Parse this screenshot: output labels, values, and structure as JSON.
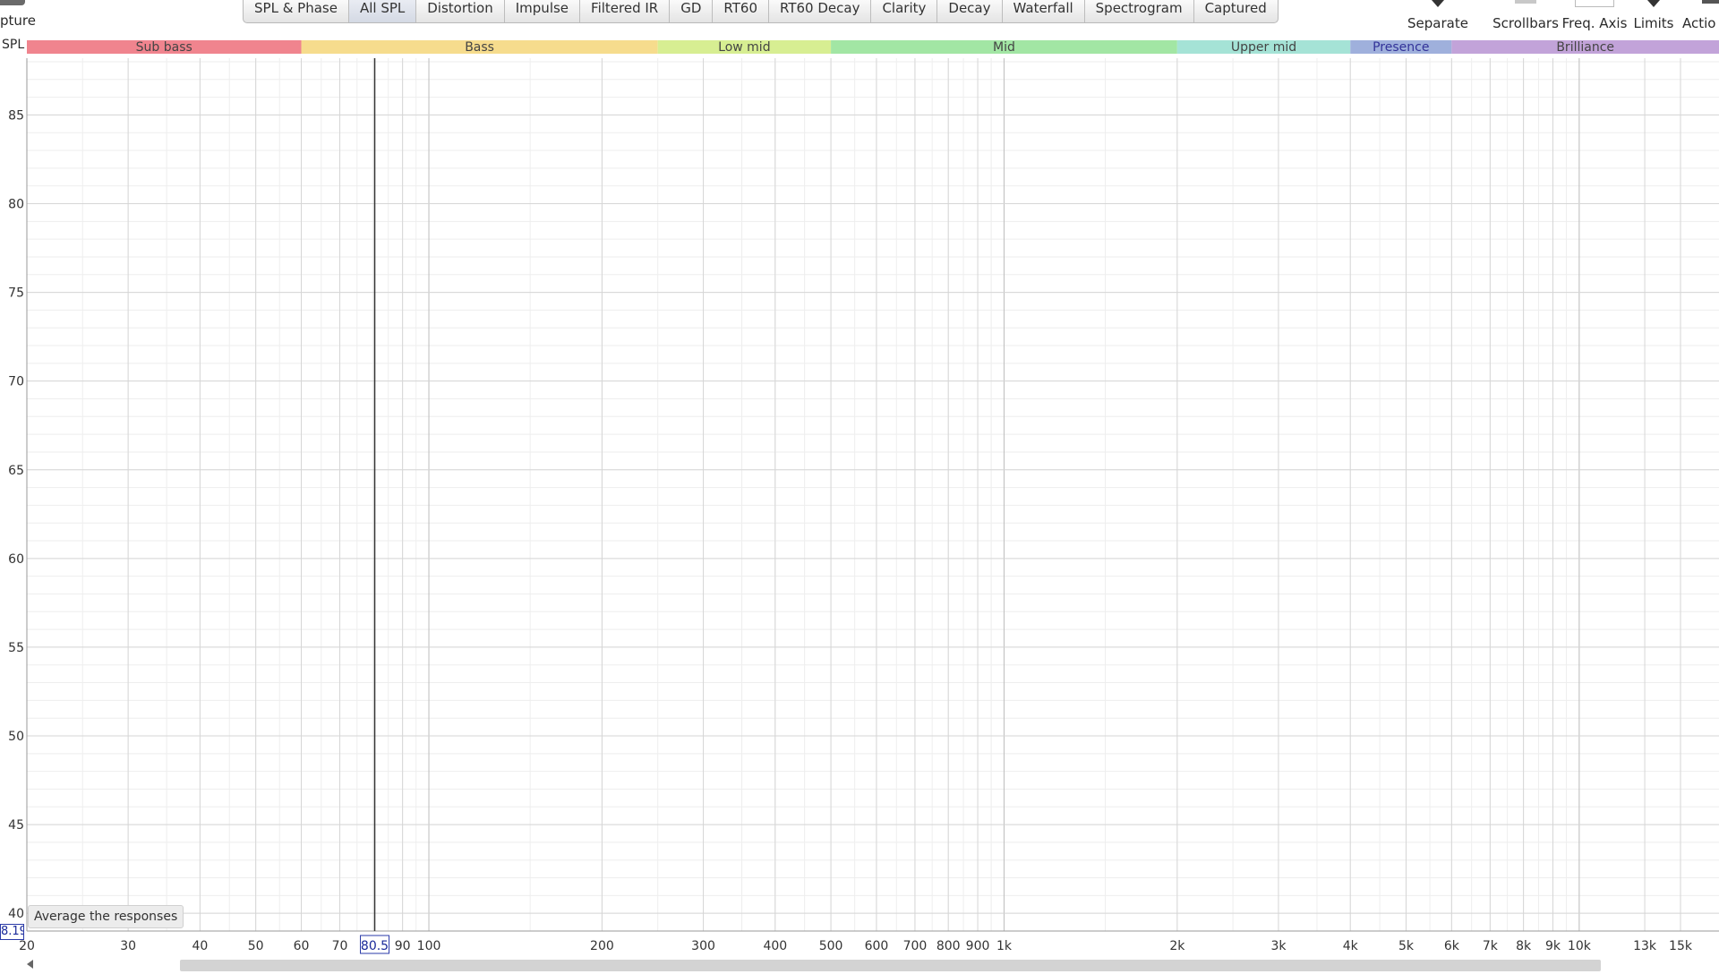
{
  "capture_label": "pture",
  "tabs": [
    {
      "label": "SPL & Phase",
      "active": false
    },
    {
      "label": "All SPL",
      "active": true
    },
    {
      "label": "Distortion",
      "active": false
    },
    {
      "label": "Impulse",
      "active": false
    },
    {
      "label": "Filtered IR",
      "active": false
    },
    {
      "label": "GD",
      "active": false
    },
    {
      "label": "RT60",
      "active": false
    },
    {
      "label": "RT60 Decay",
      "active": false
    },
    {
      "label": "Clarity",
      "active": false
    },
    {
      "label": "Decay",
      "active": false
    },
    {
      "label": "Waterfall",
      "active": false
    },
    {
      "label": "Spectrogram",
      "active": false
    },
    {
      "label": "Captured",
      "active": false
    }
  ],
  "toolbar": {
    "separate": "Separate",
    "scrollbars": "Scrollbars",
    "freq_axis": "Freq. Axis",
    "limits": "Limits",
    "actions": "Actio"
  },
  "y_axis_label": "SPL",
  "average_button": "Average the responses",
  "cursor": {
    "y_value": "8.19",
    "x_value": "80.5",
    "x_freq": 80.5
  },
  "bands": [
    {
      "label": "Sub bass",
      "from": 20,
      "to": 60,
      "color": "#f0848e",
      "text_color": "#444444"
    },
    {
      "label": "Bass",
      "from": 60,
      "to": 250,
      "color": "#f6dc8d",
      "text_color": "#444444"
    },
    {
      "label": "Low mid",
      "from": 250,
      "to": 500,
      "color": "#d7ee92",
      "text_color": "#444444"
    },
    {
      "label": "Mid",
      "from": 500,
      "to": 2000,
      "color": "#a2e6a4",
      "text_color": "#444444"
    },
    {
      "label": "Upper mid",
      "from": 2000,
      "to": 4000,
      "color": "#a5e3d6",
      "text_color": "#444444"
    },
    {
      "label": "Presence",
      "from": 4000,
      "to": 6000,
      "color": "#9fb0dc",
      "text_color": "#333399"
    },
    {
      "label": "Brilliance",
      "from": 6000,
      "to": 20000,
      "color": "#c2a3d9",
      "text_color": "#444444"
    }
  ],
  "chart_data": {
    "type": "line",
    "title": "",
    "xlabel": "",
    "ylabel": "SPL",
    "x_scale": "log",
    "xlim": [
      20,
      17500
    ],
    "ylim": [
      39,
      88.2
    ],
    "grid": true,
    "series": [],
    "y_ticks": [
      {
        "v": 40,
        "label": "40"
      },
      {
        "v": 45,
        "label": "45"
      },
      {
        "v": 50,
        "label": "50"
      },
      {
        "v": 55,
        "label": "55"
      },
      {
        "v": 60,
        "label": "60"
      },
      {
        "v": 65,
        "label": "65"
      },
      {
        "v": 70,
        "label": "70"
      },
      {
        "v": 75,
        "label": "75"
      },
      {
        "v": 80,
        "label": "80"
      },
      {
        "v": 85,
        "label": "85"
      }
    ],
    "x_ticks": [
      {
        "v": 20,
        "label": "20"
      },
      {
        "v": 30,
        "label": "30"
      },
      {
        "v": 40,
        "label": "40"
      },
      {
        "v": 50,
        "label": "50"
      },
      {
        "v": 60,
        "label": "60"
      },
      {
        "v": 70,
        "label": "70"
      },
      {
        "v": 90,
        "label": "90"
      },
      {
        "v": 100,
        "label": "100"
      },
      {
        "v": 200,
        "label": "200"
      },
      {
        "v": 300,
        "label": "300"
      },
      {
        "v": 400,
        "label": "400"
      },
      {
        "v": 500,
        "label": "500"
      },
      {
        "v": 600,
        "label": "600"
      },
      {
        "v": 700,
        "label": "700"
      },
      {
        "v": 800,
        "label": "800"
      },
      {
        "v": 900,
        "label": "900"
      },
      {
        "v": 1000,
        "label": "1k"
      },
      {
        "v": 2000,
        "label": "2k"
      },
      {
        "v": 3000,
        "label": "3k"
      },
      {
        "v": 4000,
        "label": "4k"
      },
      {
        "v": 5000,
        "label": "5k"
      },
      {
        "v": 6000,
        "label": "6k"
      },
      {
        "v": 7000,
        "label": "7k"
      },
      {
        "v": 8000,
        "label": "8k"
      },
      {
        "v": 9000,
        "label": "9k"
      },
      {
        "v": 10000,
        "label": "10k"
      },
      {
        "v": 13000,
        "label": "13k"
      },
      {
        "v": 15000,
        "label": "15k"
      }
    ]
  }
}
